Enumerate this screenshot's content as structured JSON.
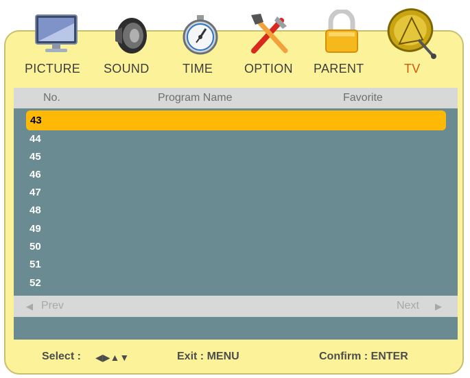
{
  "menu": {
    "tabs": [
      {
        "label": "PICTURE",
        "icon": "monitor-icon"
      },
      {
        "label": "SOUND",
        "icon": "speaker-icon"
      },
      {
        "label": "TIME",
        "icon": "stopwatch-icon"
      },
      {
        "label": "OPTION",
        "icon": "tools-icon"
      },
      {
        "label": "PARENT",
        "icon": "padlock-icon"
      },
      {
        "label": "TV",
        "icon": "satellite-dish-icon"
      }
    ],
    "active_tab": "TV"
  },
  "list": {
    "columns": {
      "no": "No.",
      "name": "Program Name",
      "favorite": "Favorite"
    },
    "rows": [
      "43",
      "44",
      "45",
      "46",
      "47",
      "48",
      "49",
      "50",
      "51",
      "52"
    ],
    "selected": "43"
  },
  "nav": {
    "prev": "Prev",
    "next": "Next",
    "prev_arrow": "◀",
    "next_arrow": "▶"
  },
  "footer": {
    "select_label": "Select :",
    "select_arrows": "◀▶▲▼",
    "exit": "Exit : MENU",
    "confirm": "Confirm : ENTER"
  },
  "colors": {
    "panel_bg": "#fbf29a",
    "list_bg": "#6a8b91",
    "header_bg": "#d7d8d8",
    "highlight": "#fdb906",
    "active_tab": "#cc5a06"
  }
}
